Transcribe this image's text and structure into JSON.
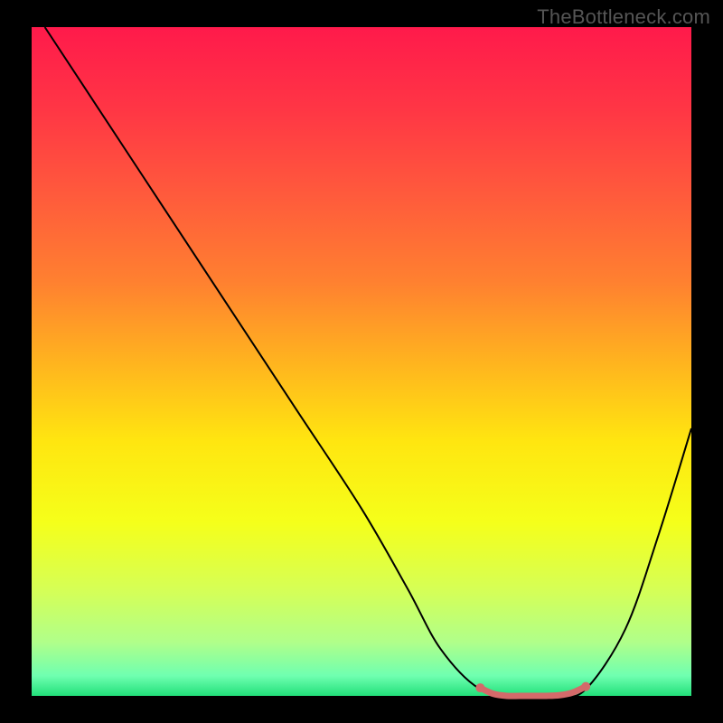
{
  "watermark": "TheBottleneck.com",
  "gradient": {
    "stops": [
      {
        "offset": 0.0,
        "color": "#ff1a4b"
      },
      {
        "offset": 0.12,
        "color": "#ff3545"
      },
      {
        "offset": 0.25,
        "color": "#ff5a3c"
      },
      {
        "offset": 0.38,
        "color": "#ff8030"
      },
      {
        "offset": 0.5,
        "color": "#ffb31f"
      },
      {
        "offset": 0.62,
        "color": "#ffe610"
      },
      {
        "offset": 0.74,
        "color": "#f5ff1a"
      },
      {
        "offset": 0.84,
        "color": "#d6ff55"
      },
      {
        "offset": 0.92,
        "color": "#b0ff8a"
      },
      {
        "offset": 0.97,
        "color": "#6fffb0"
      },
      {
        "offset": 1.0,
        "color": "#22e07a"
      }
    ]
  },
  "chart_data": {
    "type": "line",
    "title": "",
    "xlabel": "",
    "ylabel": "",
    "xlim": [
      0,
      100
    ],
    "ylim": [
      0,
      100
    ],
    "series": [
      {
        "name": "bottleneck-curve",
        "x": [
          2,
          10,
          20,
          30,
          40,
          50,
          57,
          62,
          68,
          74,
          80,
          84,
          90,
          95,
          100
        ],
        "y": [
          100,
          88,
          73,
          58,
          43,
          28,
          16,
          7,
          1,
          0,
          0,
          1,
          10,
          24,
          40
        ],
        "stroke": "#000000",
        "stroke_width": 2
      },
      {
        "name": "highlight-trough",
        "x": [
          68,
          70,
          72,
          74,
          76,
          78,
          80,
          82,
          84
        ],
        "y": [
          1.2,
          0.3,
          0,
          0,
          0,
          0,
          0.1,
          0.5,
          1.4
        ],
        "stroke": "#d46a6a",
        "stroke_width": 7
      }
    ],
    "markers": [
      {
        "name": "trough-left-dot",
        "x": 68,
        "y": 1.2,
        "r": 5,
        "fill": "#d46a6a"
      },
      {
        "name": "trough-right-dot",
        "x": 84,
        "y": 1.4,
        "r": 5,
        "fill": "#d46a6a"
      }
    ]
  }
}
